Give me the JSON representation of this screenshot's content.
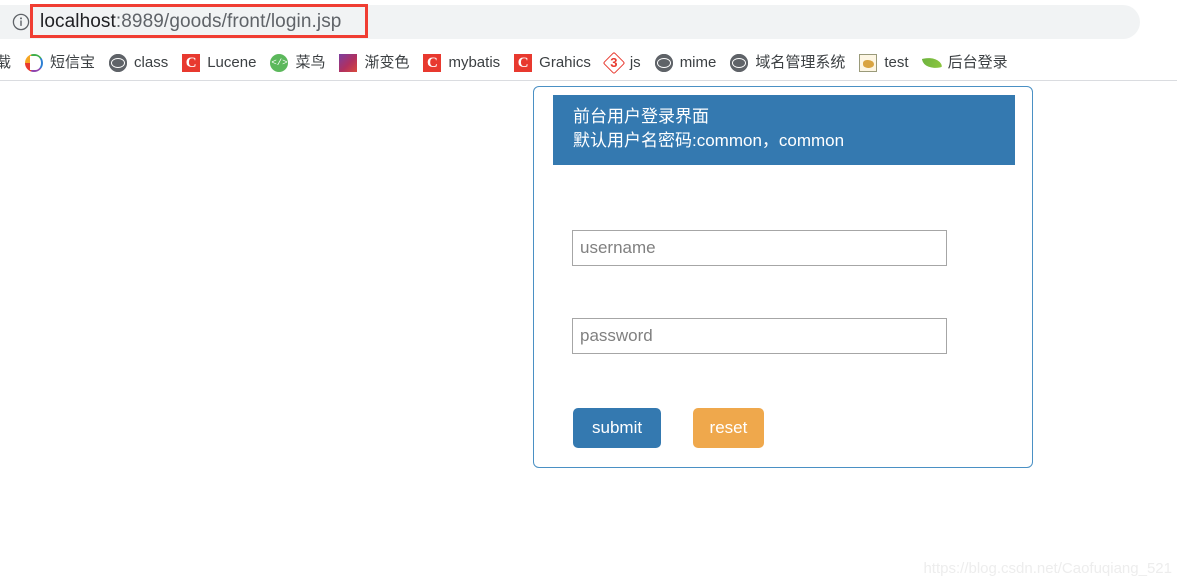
{
  "browser": {
    "info_icon": "info-circle-icon",
    "url_host": "localhost",
    "url_path": ":8989/goods/front/login.jsp",
    "annotation_color": "#f03d32"
  },
  "bookmarks": {
    "items": [
      {
        "label": "载",
        "icon": "clipped-bookmark-icon",
        "icon_type": "none"
      },
      {
        "label": "短信宝",
        "icon": "csdn-color-icon",
        "icon_type": "csdn-color"
      },
      {
        "label": "class",
        "icon": "globe-icon",
        "icon_type": "globe"
      },
      {
        "label": "Lucene",
        "icon": "csdn-red-icon",
        "icon_type": "csdn-red",
        "glyph": "C"
      },
      {
        "label": "菜鸟",
        "icon": "cainiao-code-icon",
        "icon_type": "cainiao",
        "glyph": "&lt;/&gt;"
      },
      {
        "label": "渐变色",
        "icon": "gradient-swatch-icon",
        "icon_type": "gradient"
      },
      {
        "label": "mybatis",
        "icon": "csdn-red-icon",
        "icon_type": "csdn-red",
        "glyph": "C"
      },
      {
        "label": "Grahics",
        "icon": "csdn-red-icon",
        "icon_type": "csdn-red",
        "glyph": "C"
      },
      {
        "label": "js",
        "icon": "threejs-icon",
        "icon_type": "three",
        "glyph": "3"
      },
      {
        "label": "mime",
        "icon": "globe-icon",
        "icon_type": "globe"
      },
      {
        "label": "域名管理系统",
        "icon": "globe-icon",
        "icon_type": "globe"
      },
      {
        "label": "test",
        "icon": "tomcat-icon",
        "icon_type": "tomcat"
      },
      {
        "label": "后台登录",
        "icon": "spring-leaf-icon",
        "icon_type": "spring"
      }
    ]
  },
  "login": {
    "header_title": "前台用户登录界面",
    "header_subtitle": "默认用户名密码:common，common",
    "username_placeholder": "username",
    "password_placeholder": "password",
    "username_value": "",
    "password_value": "",
    "submit_label": "submit",
    "reset_label": "reset",
    "header_bg": "#3479b0",
    "submit_bg": "#3479b0",
    "reset_bg": "#efa84c",
    "border_color": "#4a90c4"
  },
  "watermark": {
    "text": "https://blog.csdn.net/Caofuqiang_521"
  }
}
